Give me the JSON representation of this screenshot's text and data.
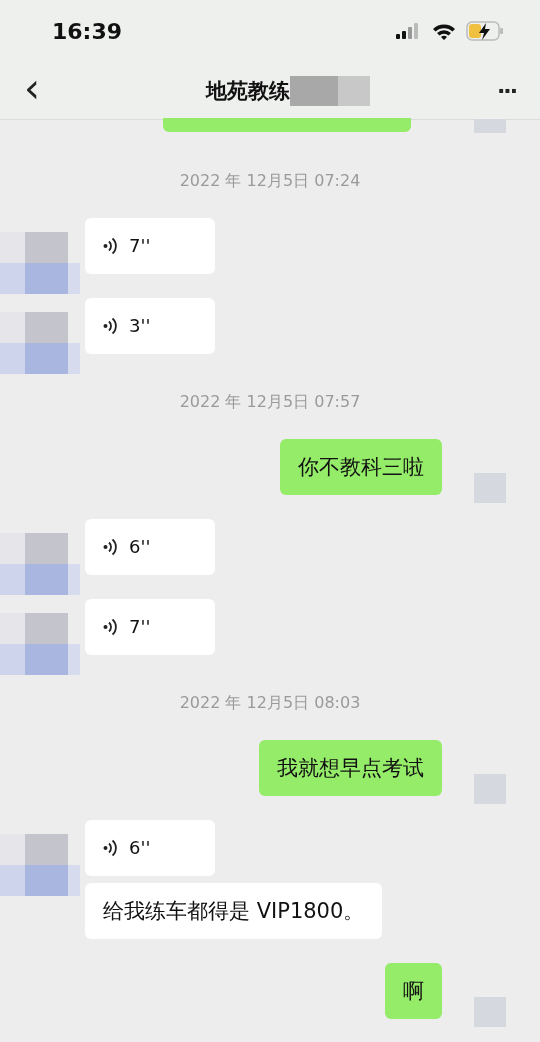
{
  "status_bar": {
    "time": "16:39",
    "charging": true
  },
  "nav": {
    "back": "‹",
    "title": "地苑教练",
    "more": "···"
  },
  "messages": [
    {
      "kind": "partial_sent",
      "avatar": true
    },
    {
      "kind": "time",
      "text": "2022 年 12月5日 07:24"
    },
    {
      "kind": "voice_received",
      "avatar": true,
      "duration": "7''"
    },
    {
      "kind": "voice_received",
      "avatar": true,
      "duration": "3''"
    },
    {
      "kind": "time",
      "text": "2022 年 12月5日 07:57"
    },
    {
      "kind": "text_sent",
      "avatar": true,
      "text": "你不教科三啦"
    },
    {
      "kind": "voice_received",
      "avatar": true,
      "duration": "6''"
    },
    {
      "kind": "voice_received",
      "avatar": true,
      "duration": "7''"
    },
    {
      "kind": "time",
      "text": "2022 年 12月5日 08:03"
    },
    {
      "kind": "text_sent",
      "avatar": true,
      "text": "我就想早点考试"
    },
    {
      "kind": "voice_received",
      "avatar": true,
      "duration": "6''"
    },
    {
      "kind": "text_received",
      "avatar": false,
      "text": "给我练车都得是 VIP1800。"
    },
    {
      "kind": "text_sent",
      "avatar": true,
      "text": "啊"
    }
  ]
}
